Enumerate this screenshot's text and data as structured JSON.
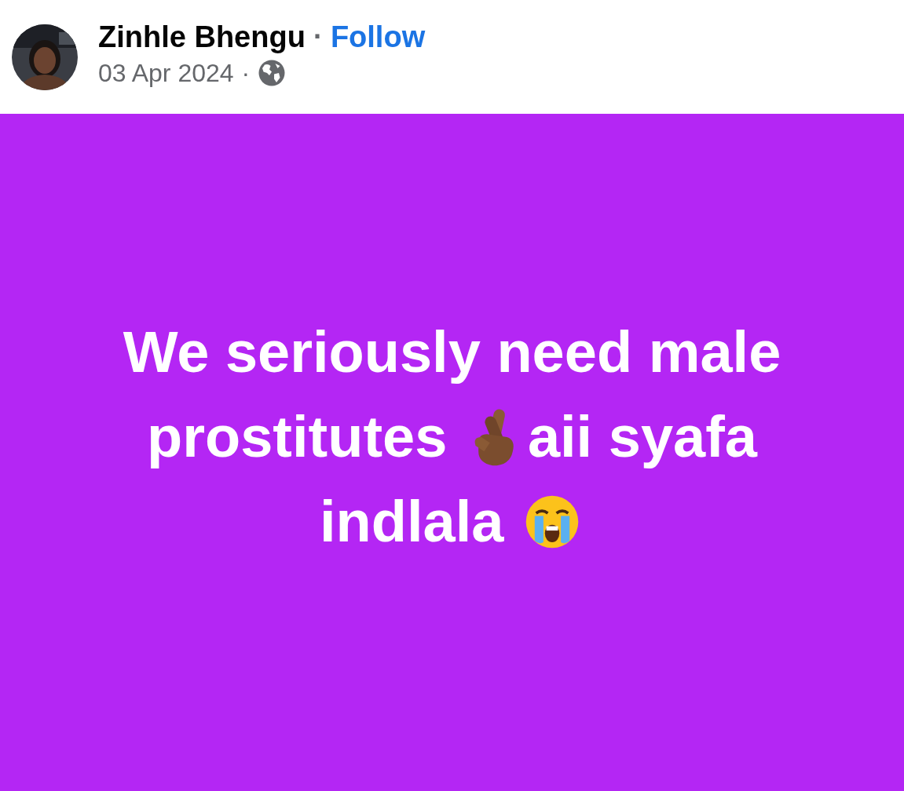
{
  "post_header": {
    "author": "Zinhle Bhengu",
    "separator": "·",
    "follow": "Follow",
    "date": "03 Apr 2024",
    "date_separator": "·"
  },
  "post_body": {
    "lines": [
      [
        {
          "kind": "text",
          "text": "We seriously need male"
        }
      ],
      [
        {
          "kind": "text",
          "text": "prostitutes "
        },
        {
          "kind": "crossed-fingers"
        },
        {
          "kind": "text",
          "text": "aii syafa"
        }
      ],
      [
        {
          "kind": "text",
          "text": "indlala "
        },
        {
          "kind": "crying-face"
        }
      ]
    ]
  }
}
